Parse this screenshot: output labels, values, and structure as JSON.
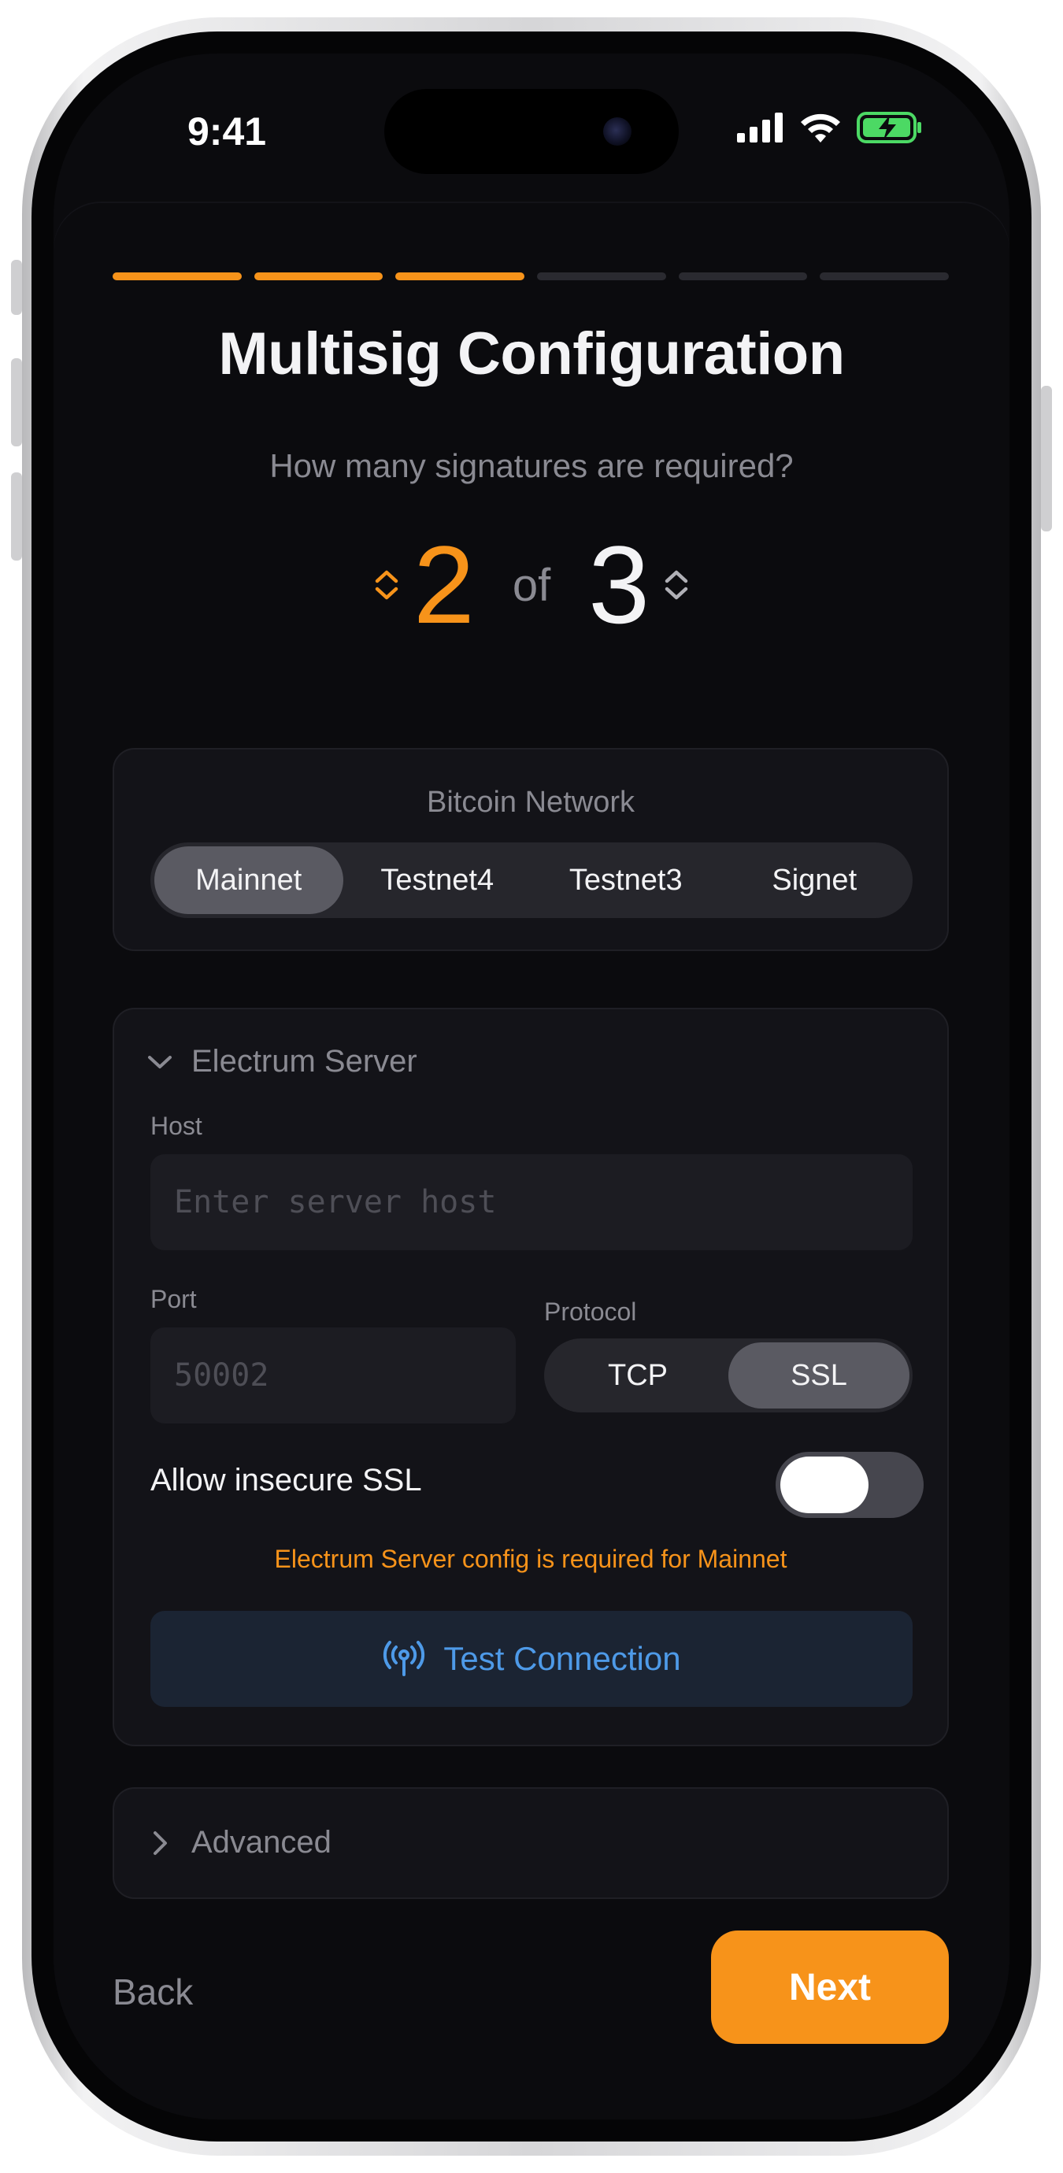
{
  "status_bar": {
    "time": "9:41"
  },
  "progress": {
    "total_steps": 6,
    "completed_steps": 3
  },
  "page": {
    "title": "Multisig Configuration",
    "question": "How many signatures are required?"
  },
  "multisig": {
    "m": "2",
    "of_label": "of",
    "n": "3"
  },
  "network": {
    "label": "Bitcoin Network",
    "options": [
      "Mainnet",
      "Testnet4",
      "Testnet3",
      "Signet"
    ],
    "selected": "Mainnet"
  },
  "electrum": {
    "header": "Electrum Server",
    "host_label": "Host",
    "host_placeholder": "Enter server host",
    "port_label": "Port",
    "port_placeholder": "50002",
    "protocol_label": "Protocol",
    "protocol_options": [
      "TCP",
      "SSL"
    ],
    "protocol_selected": "SSL",
    "insecure_label": "Allow insecure SSL",
    "insecure_enabled": false,
    "warning": "Electrum Server config is required for Mainnet",
    "test_button": "Test Connection"
  },
  "advanced": {
    "header": "Advanced"
  },
  "nav": {
    "back": "Back",
    "next": "Next"
  },
  "colors": {
    "accent": "#f7931a",
    "link": "#4e9ae8",
    "background": "#0b0b0e"
  },
  "icons": {
    "stepper": "chevron-up-down-icon",
    "expanded": "chevron-down-icon",
    "collapsed": "chevron-right-icon",
    "test": "antenna-icon"
  }
}
